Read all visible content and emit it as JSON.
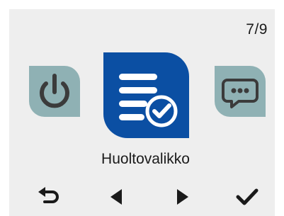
{
  "header": {
    "page_indicator": "7/9"
  },
  "menu": {
    "selected_label": "Huoltovalikko",
    "items": [
      {
        "icon": "power-icon",
        "position": "previous"
      },
      {
        "icon": "service-checklist-icon",
        "position": "selected"
      },
      {
        "icon": "message-icon",
        "position": "next"
      }
    ]
  },
  "nav": {
    "icons": [
      "back-arrow-icon",
      "left-triangle-icon",
      "right-triangle-icon",
      "checkmark-icon"
    ]
  },
  "colors": {
    "screen_background": "#eeeeee",
    "selected_tile": "#0b4fa3",
    "inactive_tile": "#8fb1b4",
    "inactive_icon": "#3b3b3b",
    "text": "#1a1a1a"
  }
}
